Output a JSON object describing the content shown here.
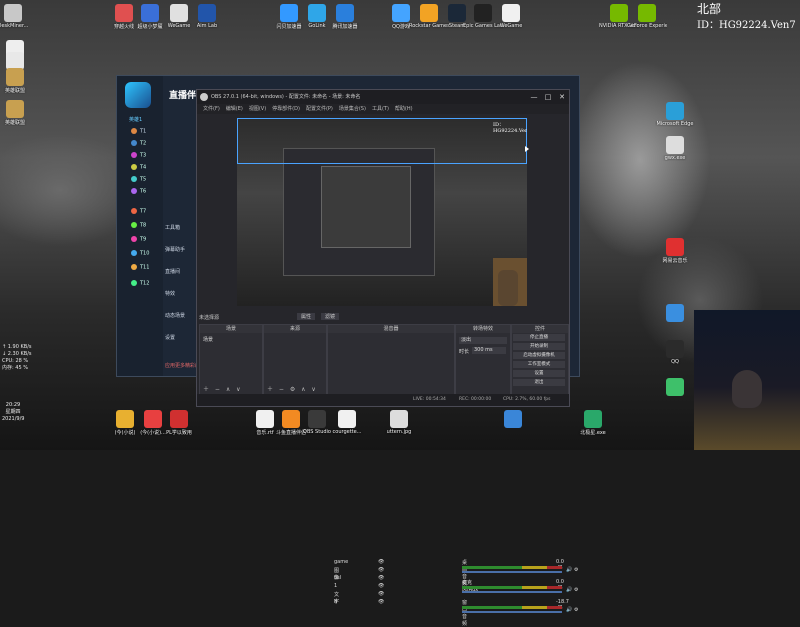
{
  "overlay": {
    "region": "北部",
    "id_text": "ID：HG92224.Ven7"
  },
  "desktop_icons_top": [
    {
      "label": "DeskMiner...",
      "color": "#c8c8c8"
    },
    {
      "label": "穿越火线",
      "color": "#e05050"
    },
    {
      "label": "超级小梦魇",
      "color": "#3a6fd8"
    },
    {
      "label": "WeGame",
      "color": "#e0e0e0"
    },
    {
      "label": "Aim Lab",
      "color": "#2255aa"
    },
    {
      "label": "闪贝加速器",
      "color": "#3399ff"
    },
    {
      "label": "GoLink",
      "color": "#2fa6e8"
    },
    {
      "label": "腾讯加速器",
      "color": "#2a7fdc"
    },
    {
      "label": "QQ游戏",
      "color": "#44a4ff"
    },
    {
      "label": "Rockstar Games ...",
      "color": "#f2a324"
    },
    {
      "label": "Steam",
      "color": "#1b2838"
    },
    {
      "label": "Epic Games Launcher",
      "color": "#222222"
    },
    {
      "label": "WeGame",
      "color": "#f0f0f0"
    },
    {
      "label": "NVIDIA RTX Voice",
      "color": "#76b900"
    },
    {
      "label": "GeForce Experience",
      "color": "#76b900"
    }
  ],
  "desktop_icons_left": [
    {
      "label": "",
      "color": "#eeeeee"
    },
    {
      "label": "",
      "color": "#e8e8e8"
    },
    {
      "label": "英雄联盟",
      "color": "#c8a050"
    },
    {
      "label": "英雄联盟",
      "color": "#c8a050"
    }
  ],
  "desktop_icons_right": [
    {
      "label": "Microsoft Edge",
      "color": "#2a9fd8"
    },
    {
      "label": "gwx.exe",
      "color": "#dddddd"
    },
    {
      "label": "网易云音乐",
      "color": "#e03030"
    },
    {
      "label": "",
      "color": "#3a8fe0"
    },
    {
      "label": "QQ",
      "color": "#2b2b2b"
    },
    {
      "label": "",
      "color": "#3ec06a"
    }
  ],
  "taskbar_icons": [
    {
      "label": "(今(小说)",
      "color": "#e8b030"
    },
    {
      "label": "(今(小说)...",
      "color": "#e84040"
    },
    {
      "label": "PL学以致用",
      "color": "#d03030"
    },
    {
      "label": "音乐.rtf",
      "color": "#f0f0f0"
    },
    {
      "label": "斗鱼直播伴侣",
      "color": "#f28a22"
    },
    {
      "label": "OBS Studio",
      "color": "#3a3a3a"
    },
    {
      "label": "courgette...",
      "color": "#f0f0f0"
    },
    {
      "label": "uttern.jpg",
      "color": "#dddddd"
    },
    {
      "label": "",
      "color": "#3a86d8"
    },
    {
      "label": "北极星.exe",
      "color": "#2aa86a"
    }
  ],
  "sys_stats": [
    "↑ 1.90 KB/s",
    "↓ 2.30 KB/s",
    "CPU: 28 %",
    "内存: 45 %"
  ],
  "clock": {
    "time": "20:29",
    "weekday": "星期四",
    "date": "2021/9/9"
  },
  "app": {
    "title": "直播伴侣",
    "sidebar_header": "英雄1",
    "menu_items": [
      "工具箱",
      "弹幕助手",
      "直播间",
      "特效",
      "动态场景",
      "设置"
    ],
    "footer_text": "应用更多精彩的功能"
  },
  "obs": {
    "window_title": "OBS 27.0.1 (64-bit, windows) - 配置文件: 未命名 - 场景: 未命名",
    "menu": [
      "文件(F)",
      "编辑(E)",
      "视图(V)",
      "停靠部件(D)",
      "配置文件(P)",
      "场景集合(S)",
      "工具(T)",
      "帮助(H)"
    ],
    "no_source_label": "未选择源",
    "properties_btn": "属性",
    "filters_btn": "滤镜",
    "docks": {
      "scenes": "场景",
      "sources": "来源",
      "mixer": "混音器",
      "transitions": "转场特效",
      "controls": "控件"
    },
    "scene_items": [
      "场景"
    ],
    "source_items": [
      "game",
      "图像",
      "bsl",
      "1",
      "文字",
      "B"
    ],
    "mixer_items": [
      {
        "name": "桌面音频",
        "db": "0.0 dB"
      },
      {
        "name": "麦克风/Aux",
        "db": "0.0 dB"
      },
      {
        "name": "窗口音频",
        "db": "-18.7 dB"
      }
    ],
    "transition": {
      "type": "淡出",
      "duration_label": "时长",
      "duration": "300 ms"
    },
    "controls": [
      "停止直播",
      "开始录制",
      "启动虚拟摄像机",
      "工作室模式",
      "设置",
      "退出"
    ],
    "status": {
      "live": "LIVE: 00:54:34",
      "rec": "REC: 00:00:00",
      "cpu": "CPU: 2.7%, 60.00 fps"
    }
  }
}
